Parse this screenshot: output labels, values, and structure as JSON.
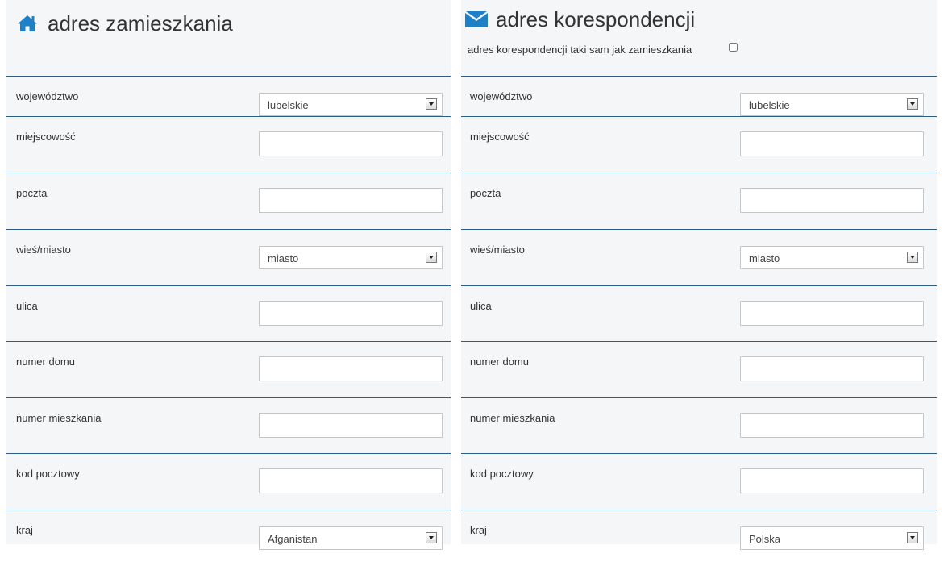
{
  "left": {
    "title": "adres zamieszkania",
    "icon": "home-icon",
    "fields": [
      {
        "label": "województwo",
        "type": "select",
        "value": "lubelskie"
      },
      {
        "label": "miejscowość",
        "type": "input",
        "value": ""
      },
      {
        "label": "poczta",
        "type": "input",
        "value": ""
      },
      {
        "label": "wieś/miasto",
        "type": "select",
        "value": "miasto"
      },
      {
        "label": "ulica",
        "type": "input",
        "value": ""
      },
      {
        "label": "numer domu",
        "type": "input",
        "value": ""
      },
      {
        "label": "numer mieszkania",
        "type": "input",
        "value": ""
      },
      {
        "label": "kod pocztowy",
        "type": "input",
        "value": ""
      },
      {
        "label": "kraj",
        "type": "select",
        "value": "Afganistan"
      }
    ]
  },
  "right": {
    "title": "adres korespondencji",
    "icon": "envelope-icon",
    "same_as_label": "adres korespondencji taki sam jak zamieszkania",
    "same_as_checked": false,
    "fields": [
      {
        "label": "województwo",
        "type": "select",
        "value": "lubelskie"
      },
      {
        "label": "miejscowość",
        "type": "input",
        "value": ""
      },
      {
        "label": "poczta",
        "type": "input",
        "value": ""
      },
      {
        "label": "wieś/miasto",
        "type": "select",
        "value": "miasto"
      },
      {
        "label": "ulica",
        "type": "input",
        "value": ""
      },
      {
        "label": "numer domu",
        "type": "input",
        "value": ""
      },
      {
        "label": "numer mieszkania",
        "type": "input",
        "value": ""
      },
      {
        "label": "kod pocztowy",
        "type": "input",
        "value": ""
      },
      {
        "label": "kraj",
        "type": "select",
        "value": "Polska"
      }
    ]
  },
  "colors": {
    "accent": "#1e81c8",
    "panel_bg": "#f5f6f7",
    "row_divider": "#2f5b87"
  }
}
